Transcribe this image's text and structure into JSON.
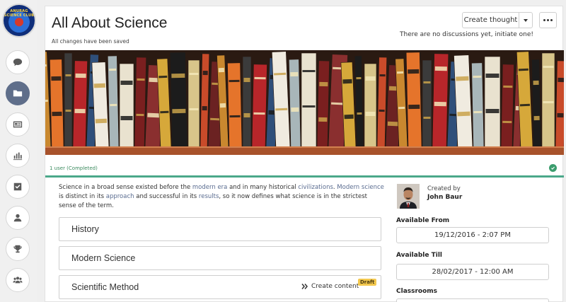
{
  "sidebar": {
    "logo_text": "ANURAG SCIENCE CLUB",
    "items": [
      {
        "icon": "chat-bubble-icon",
        "active": false
      },
      {
        "icon": "folder-icon",
        "active": true
      },
      {
        "icon": "newspaper-icon",
        "active": false
      },
      {
        "icon": "bar-chart-icon",
        "active": false
      },
      {
        "icon": "checkbox-icon",
        "active": false
      },
      {
        "icon": "user-icon",
        "active": false
      },
      {
        "icon": "trophy-icon",
        "active": false
      },
      {
        "icon": "group-icon",
        "active": false
      }
    ]
  },
  "header": {
    "title": "All About Science",
    "save_status": "All changes have been saved",
    "create_thought_label": "Create thought",
    "discussion_note": "There are no discussions yet, initiate one!"
  },
  "banner": {
    "icon": "bookshelf-banner-image"
  },
  "status": {
    "users_text": "1 user (Completed)",
    "progress": 1.0
  },
  "description": {
    "t1": "Science in a broad sense existed before the ",
    "l1": "modern era",
    "t2": " and in many historical ",
    "l2": "civilizations",
    "t3": ". ",
    "l3": "Modern science",
    "t4": " is distinct in its ",
    "l4": "approach",
    "t5": " and successful in its ",
    "l5": "results",
    "t6": ", so it now defines what science is in the strictest sense of the term."
  },
  "sections": [
    {
      "label": "History"
    },
    {
      "label": "Modern Science"
    },
    {
      "label": "Scientific Method",
      "action": "Create content",
      "badge": "Draft"
    }
  ],
  "creator": {
    "created_by_label": "Created by",
    "name": "John Baur"
  },
  "schedule": {
    "available_from_label": "Available From",
    "available_from": "19/12/2016 - 2:07 PM",
    "available_till_label": "Available Till",
    "available_till": "28/02/2017 - 12:00 AM",
    "classrooms_label": "Classrooms"
  },
  "colors": {
    "accent": "#4ba88a",
    "active_nav": "#5f6e8a",
    "draft_badge": "#f3c84e",
    "link": "#5a6c90"
  }
}
